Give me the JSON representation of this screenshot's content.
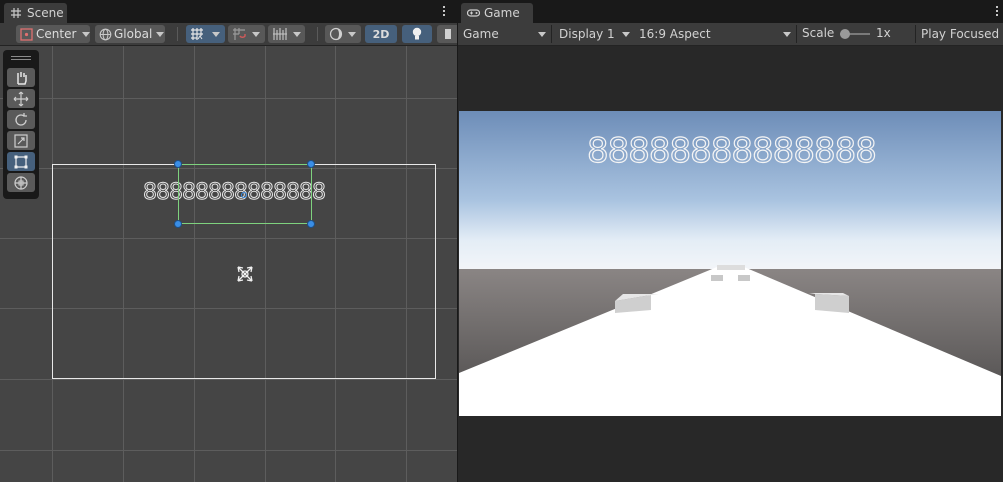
{
  "scene": {
    "tab_label": "Scene",
    "pivot_label": "Center",
    "space_label": "Global",
    "mode_2d_label": "2D",
    "text_preview": "88888888888888"
  },
  "game": {
    "tab_label": "Game",
    "view_select": "Game",
    "display_select": "Display 1",
    "aspect_select": "16:9 Aspect",
    "scale_label": "Scale",
    "scale_value": "1x",
    "play_focused_label": "Play Focused",
    "score_text": "88888888888888"
  },
  "colors": {
    "active_blue": "#46607c",
    "handle_blue": "#3a8ee6",
    "rect_green": "#7ed27e"
  }
}
